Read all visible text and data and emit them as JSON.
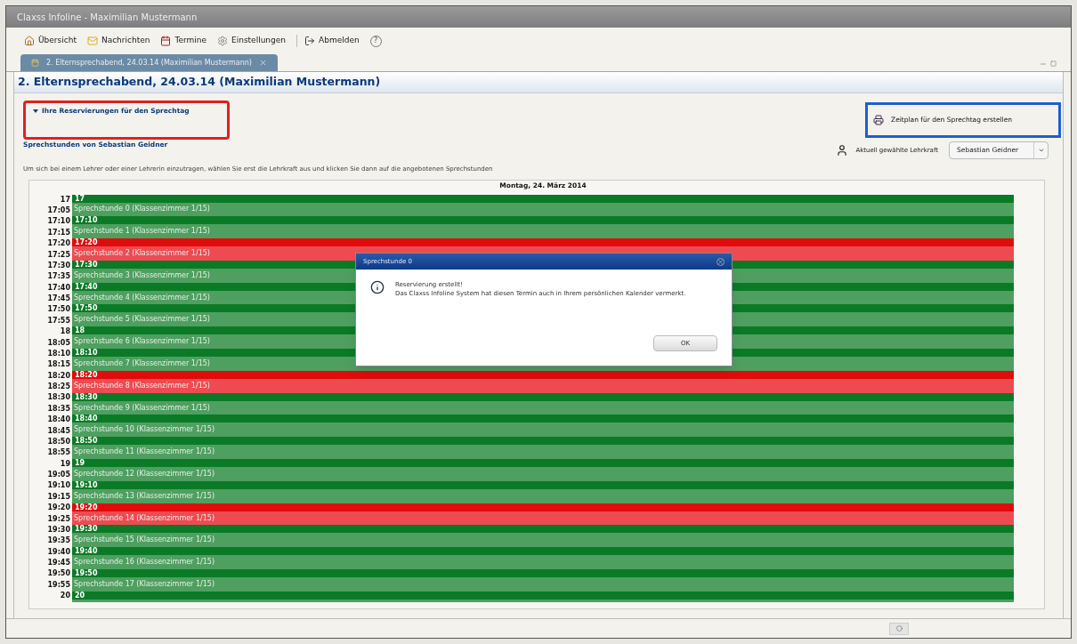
{
  "window": {
    "title": "Claxss Infoline - Maximilian Mustermann"
  },
  "toolbar": [
    {
      "label": "Übersicht",
      "kind": "overview"
    },
    {
      "label": "Nachrichten",
      "kind": "messages"
    },
    {
      "label": "Termine",
      "kind": "appointments"
    },
    {
      "label": "Einstellungen",
      "kind": "settings"
    },
    {
      "label": "Abmelden",
      "kind": "logout"
    },
    {
      "label": "?",
      "kind": "help"
    }
  ],
  "tabs": [
    {
      "label": "2. Elternsprechabend, 24.03.14 (Maximilian Mustermann)",
      "selected": true
    }
  ],
  "heading": "2. Elternsprechabend, 24.03.14 (Maximilian Mustermann)",
  "reservations": {
    "label": "Ihre Reservierungen für den Sprechtag",
    "expanded": true
  },
  "schedule_link": "Zeitplan für den Sprechtag erstellen",
  "teacher_link": "Sprechstunden von Sebastian Geidner",
  "teacher_select": {
    "label": "Aktuell gewählte Lehrkraft",
    "value": "Sebastian Geidner"
  },
  "instructions": "Um sich bei einem Lehrer oder einer Lehrerin einzutragen, wählen Sie erst die Lehrkraft aus und klicken Sie dann auf die angebotenen Sprechstunden",
  "calendar": {
    "day": "Montag, 24. März 2014",
    "times": [
      "17",
      "17:05",
      "17:10",
      "17:15",
      "17:20",
      "17:25",
      "17:30",
      "17:35",
      "17:40",
      "17:45",
      "17:50",
      "17:55",
      "18",
      "18:05",
      "18:10",
      "18:15",
      "18:20",
      "18:25",
      "18:30",
      "18:35",
      "18:40",
      "18:45",
      "18:50",
      "18:55",
      "19",
      "19:05",
      "19:10",
      "19:15",
      "19:20",
      "19:25",
      "19:30",
      "19:35",
      "19:40",
      "19:45",
      "19:50",
      "19:55",
      "20"
    ],
    "events": [
      {
        "time": "17",
        "title": "Sprechstunde 0 (Klassenzimmer 1/15)",
        "booked": false
      },
      {
        "time": "17:10",
        "title": "Sprechstunde 1 (Klassenzimmer 1/15)",
        "booked": false
      },
      {
        "time": "17:20",
        "title": "Sprechstunde 2 (Klassenzimmer 1/15)",
        "booked": true
      },
      {
        "time": "17:30",
        "title": "Sprechstunde 3 (Klassenzimmer 1/15)",
        "booked": false
      },
      {
        "time": "17:40",
        "title": "Sprechstunde 4 (Klassenzimmer 1/15)",
        "booked": false
      },
      {
        "time": "17:50",
        "title": "Sprechstunde 5 (Klassenzimmer 1/15)",
        "booked": false
      },
      {
        "time": "18",
        "title": "Sprechstunde 6 (Klassenzimmer 1/15)",
        "booked": false
      },
      {
        "time": "18:10",
        "title": "Sprechstunde 7 (Klassenzimmer 1/15)",
        "booked": false
      },
      {
        "time": "18:20",
        "title": "Sprechstunde 8 (Klassenzimmer 1/15)",
        "booked": true
      },
      {
        "time": "18:30",
        "title": "Sprechstunde 9 (Klassenzimmer 1/15)",
        "booked": false
      },
      {
        "time": "18:40",
        "title": "Sprechstunde 10 (Klassenzimmer 1/15)",
        "booked": false
      },
      {
        "time": "18:50",
        "title": "Sprechstunde 11 (Klassenzimmer 1/15)",
        "booked": false
      },
      {
        "time": "19",
        "title": "Sprechstunde 12 (Klassenzimmer 1/15)",
        "booked": false
      },
      {
        "time": "19:10",
        "title": "Sprechstunde 13 (Klassenzimmer 1/15)",
        "booked": false
      },
      {
        "time": "19:20",
        "title": "Sprechstunde 14 (Klassenzimmer 1/15)",
        "booked": true
      },
      {
        "time": "19:30",
        "title": "Sprechstunde 15 (Klassenzimmer 1/15)",
        "booked": false
      },
      {
        "time": "19:40",
        "title": "Sprechstunde 16 (Klassenzimmer 1/15)",
        "booked": false
      },
      {
        "time": "19:50",
        "title": "Sprechstunde 17 (Klassenzimmer 1/15)",
        "booked": false
      },
      {
        "time": "20",
        "booked": false
      }
    ]
  },
  "dialog": {
    "title": "Sprechstunde 0",
    "heading": "Reservierung erstellt!",
    "message": "Das Claxss Infoline System hat diesen Termin auch in Ihrem persönlichen Kalender vermerkt.",
    "button": "OK"
  }
}
